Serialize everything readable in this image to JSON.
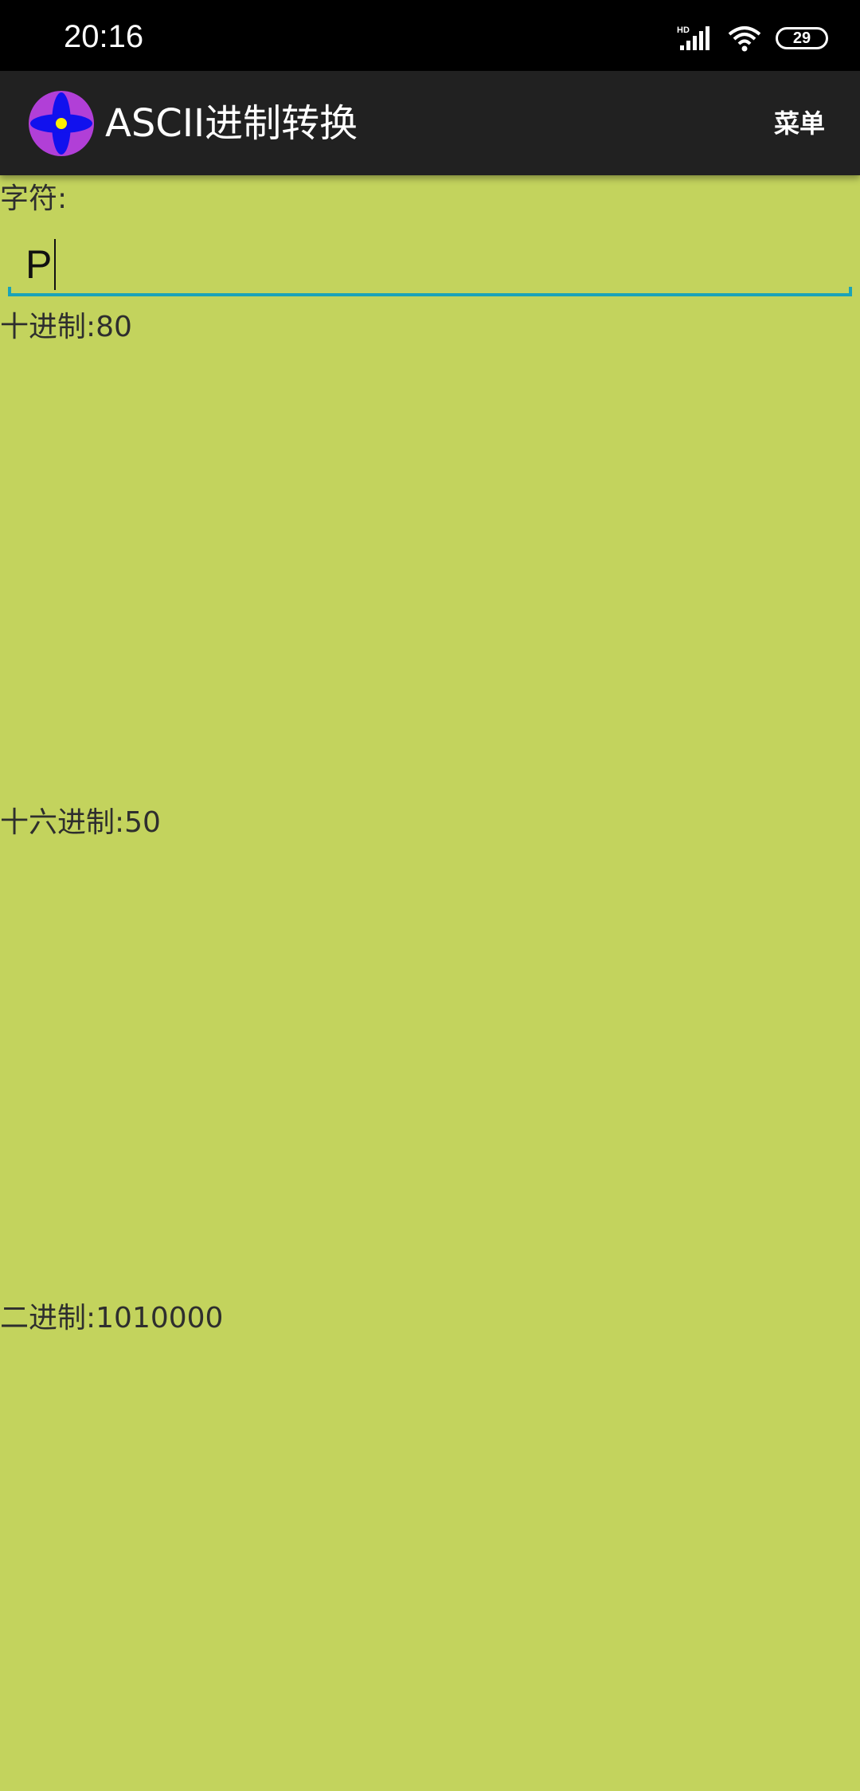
{
  "status_bar": {
    "time": "20:16",
    "battery": "29",
    "network_badge": "HD",
    "icons": [
      "signal-icon",
      "wifi-icon",
      "battery-icon"
    ]
  },
  "app_bar": {
    "title": "ASCII进制转换",
    "menu_label": "菜单",
    "icon": "app-flower-icon"
  },
  "main": {
    "char_label": "字符:",
    "char_value": "P",
    "decimal_label": "十进制:80",
    "hex_label": "十六进制:50",
    "binary_label": "二进制:1010000"
  },
  "colors": {
    "background": "#c3d35d",
    "app_bar": "#212121",
    "status_bar": "#000000",
    "accent": "#1aa3b8"
  }
}
